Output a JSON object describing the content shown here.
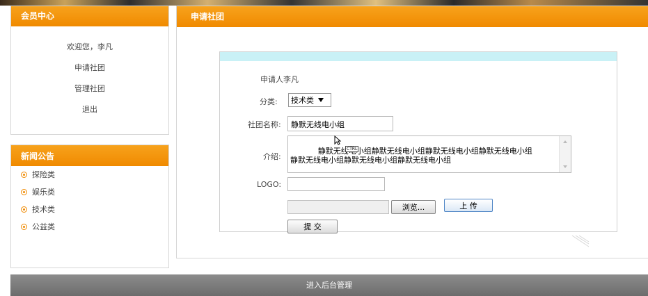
{
  "member_panel": {
    "title": "会员中心",
    "welcome": "欢迎您，李凡",
    "links": [
      "申请社团",
      "管理社团",
      "退出"
    ]
  },
  "news_panel": {
    "title": "新闻公告",
    "items": [
      "探险类",
      "娱乐类",
      "技术类",
      "公益类"
    ]
  },
  "main_panel": {
    "title": "申请社团"
  },
  "form": {
    "applicant_label": "申请人",
    "applicant_value": "李凡",
    "category_label": "分类:",
    "category_selected": "技术类",
    "club_name_label": "社团名称:",
    "club_name_value": "静默无线电小组",
    "intro_label": "介绍:",
    "intro_value": "静默无线电小组静默无线电小组静默无线电小组静默无线电小组\n静默无线电小组静默无线电小组静默无线电小组",
    "logo_label": "LOGO:",
    "logo_value": "",
    "browse_label": "浏览...",
    "upload_label": "上 传",
    "submit_label": "提 交",
    "ctrl_badge": "CTRL"
  },
  "footer": {
    "label": "进入后台管理"
  },
  "colors": {
    "orange": "#f08a00",
    "cyan_strip": "#c9f1f6",
    "footer_gray": "#7a7a7a"
  }
}
